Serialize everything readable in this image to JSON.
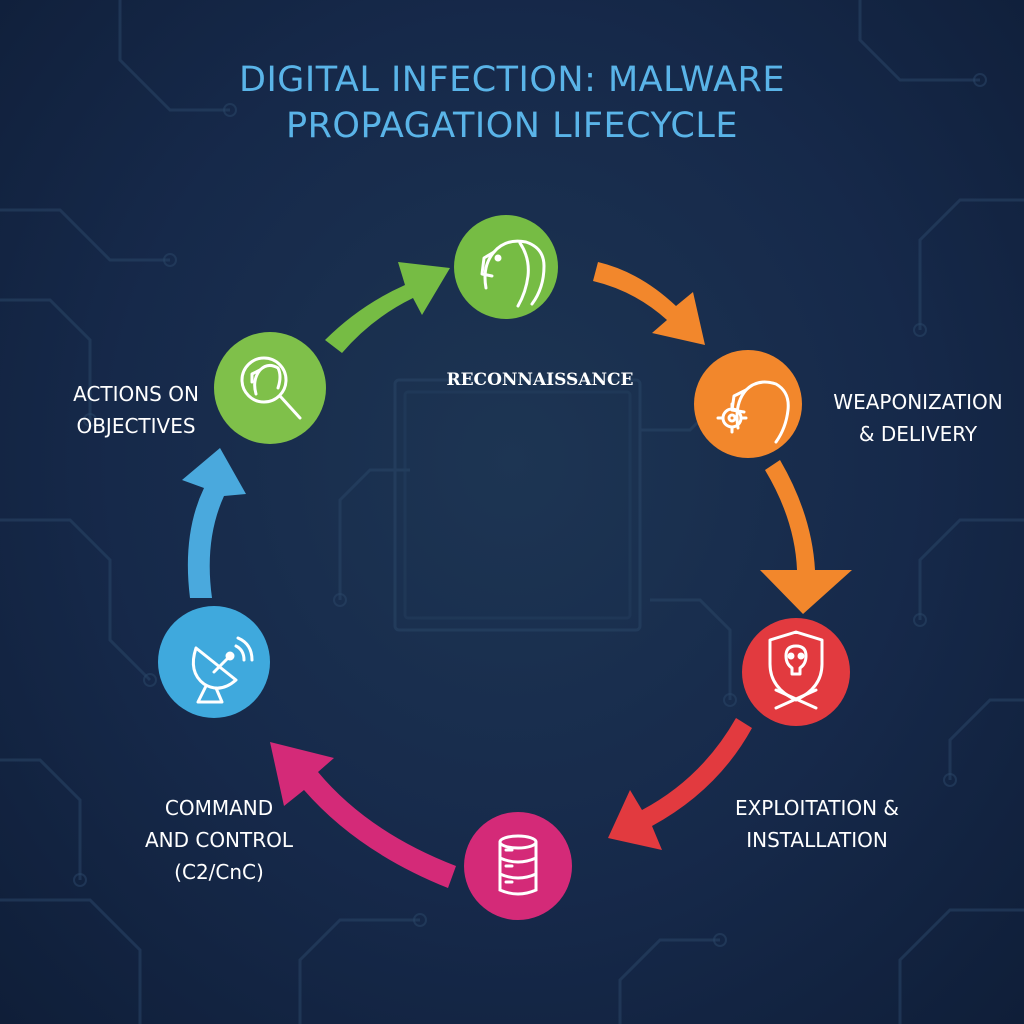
{
  "title": {
    "line1": "DIGITAL INFECTION: MALWARE",
    "line2": "PROPAGATION LIFECYCLE"
  },
  "stages": [
    {
      "id": "reconnaissance",
      "lines": [
        "RECONNAISSANCE"
      ],
      "icon": "horse-head-icon",
      "color": "#76bc44"
    },
    {
      "id": "weaponization",
      "lines": [
        "WEAPONIZATION",
        "& DELIVERY"
      ],
      "icon": "horse-gear-icon",
      "color": "#f2872c"
    },
    {
      "id": "exploitation",
      "lines": [
        "EXPLOITATION &",
        "INSTALLATION"
      ],
      "icon": "skull-shield-icon",
      "color": "#e23a3f"
    },
    {
      "id": "payload",
      "lines": [],
      "icon": "database-icon",
      "color": "#d42a78"
    },
    {
      "id": "command",
      "lines": [
        "COMMAND",
        "AND CONTROL",
        "(C2/CnC)"
      ],
      "icon": "satellite-dish-icon",
      "color": "#3fa9dd"
    },
    {
      "id": "actions",
      "lines": [
        "ACTIONS ON",
        "OBJECTIVES"
      ],
      "icon": "horse-magnifier-icon",
      "color": "#7fc04a"
    }
  ],
  "colors": {
    "background": "#16294a",
    "title": "#5ab4e8",
    "circuit": "#2a4666"
  }
}
